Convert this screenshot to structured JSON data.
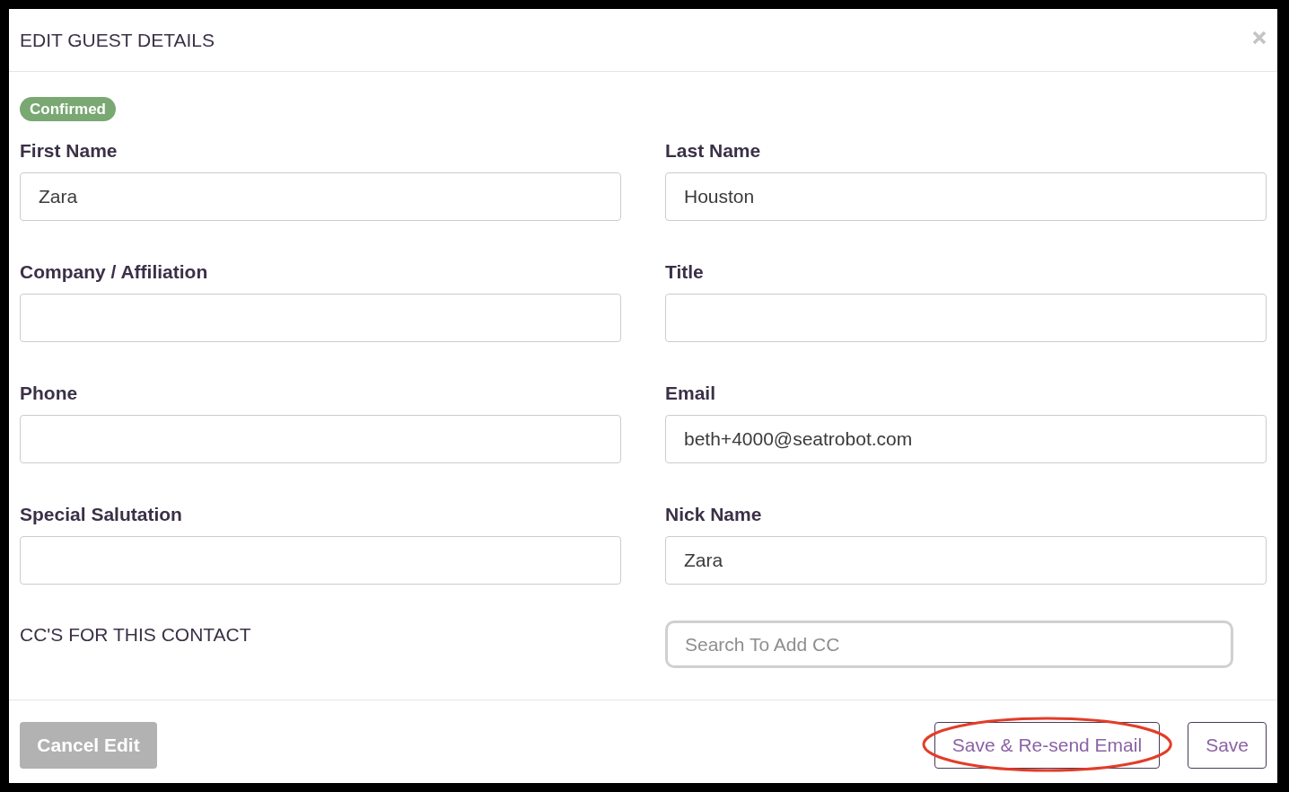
{
  "dialog": {
    "title": "EDIT GUEST DETAILS"
  },
  "status_badge": {
    "label": "Confirmed"
  },
  "fields": [
    {
      "label": "First Name",
      "value": "Zara"
    },
    {
      "label": "Last Name",
      "value": "Houston"
    },
    {
      "label": "Company / Affiliation"
    },
    {
      "label": "Title"
    },
    {
      "label": "Phone"
    },
    {
      "label": "Email",
      "value": "beth+4000@seatrobot.com"
    },
    {
      "label": "Special Salutation"
    },
    {
      "label": "Nick Name",
      "value": "Zara"
    }
  ],
  "cc": {
    "label": "CC'S FOR THIS CONTACT",
    "placeholder": "Search To Add CC"
  },
  "footer_buttons": [
    {
      "label": "Cancel Edit",
      "kind": "muted",
      "highlighted": false
    },
    {
      "label": "Save & Re-send Email",
      "kind": "outline",
      "highlighted": true
    },
    {
      "label": "Save",
      "kind": "outline",
      "highlighted": false
    }
  ]
}
